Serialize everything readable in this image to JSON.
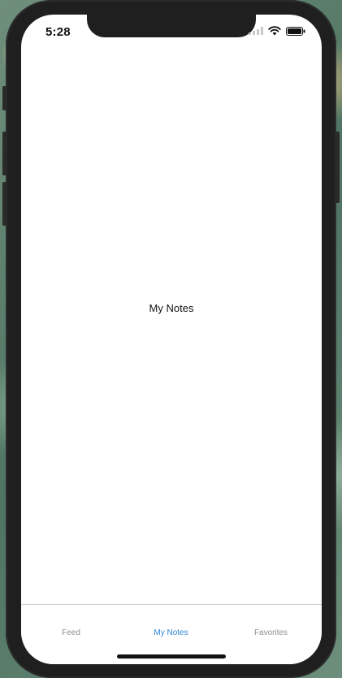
{
  "status_bar": {
    "time": "5:28",
    "icons": [
      "signal-icon",
      "wifi-icon",
      "battery-icon"
    ]
  },
  "content": {
    "title": "My Notes"
  },
  "tab_bar": {
    "tabs": [
      {
        "label": "Feed",
        "active": false
      },
      {
        "label": "My Notes",
        "active": true
      },
      {
        "label": "Favorites",
        "active": false
      }
    ],
    "active_color": "#2f86d6",
    "inactive_color": "#8e8e8e"
  }
}
